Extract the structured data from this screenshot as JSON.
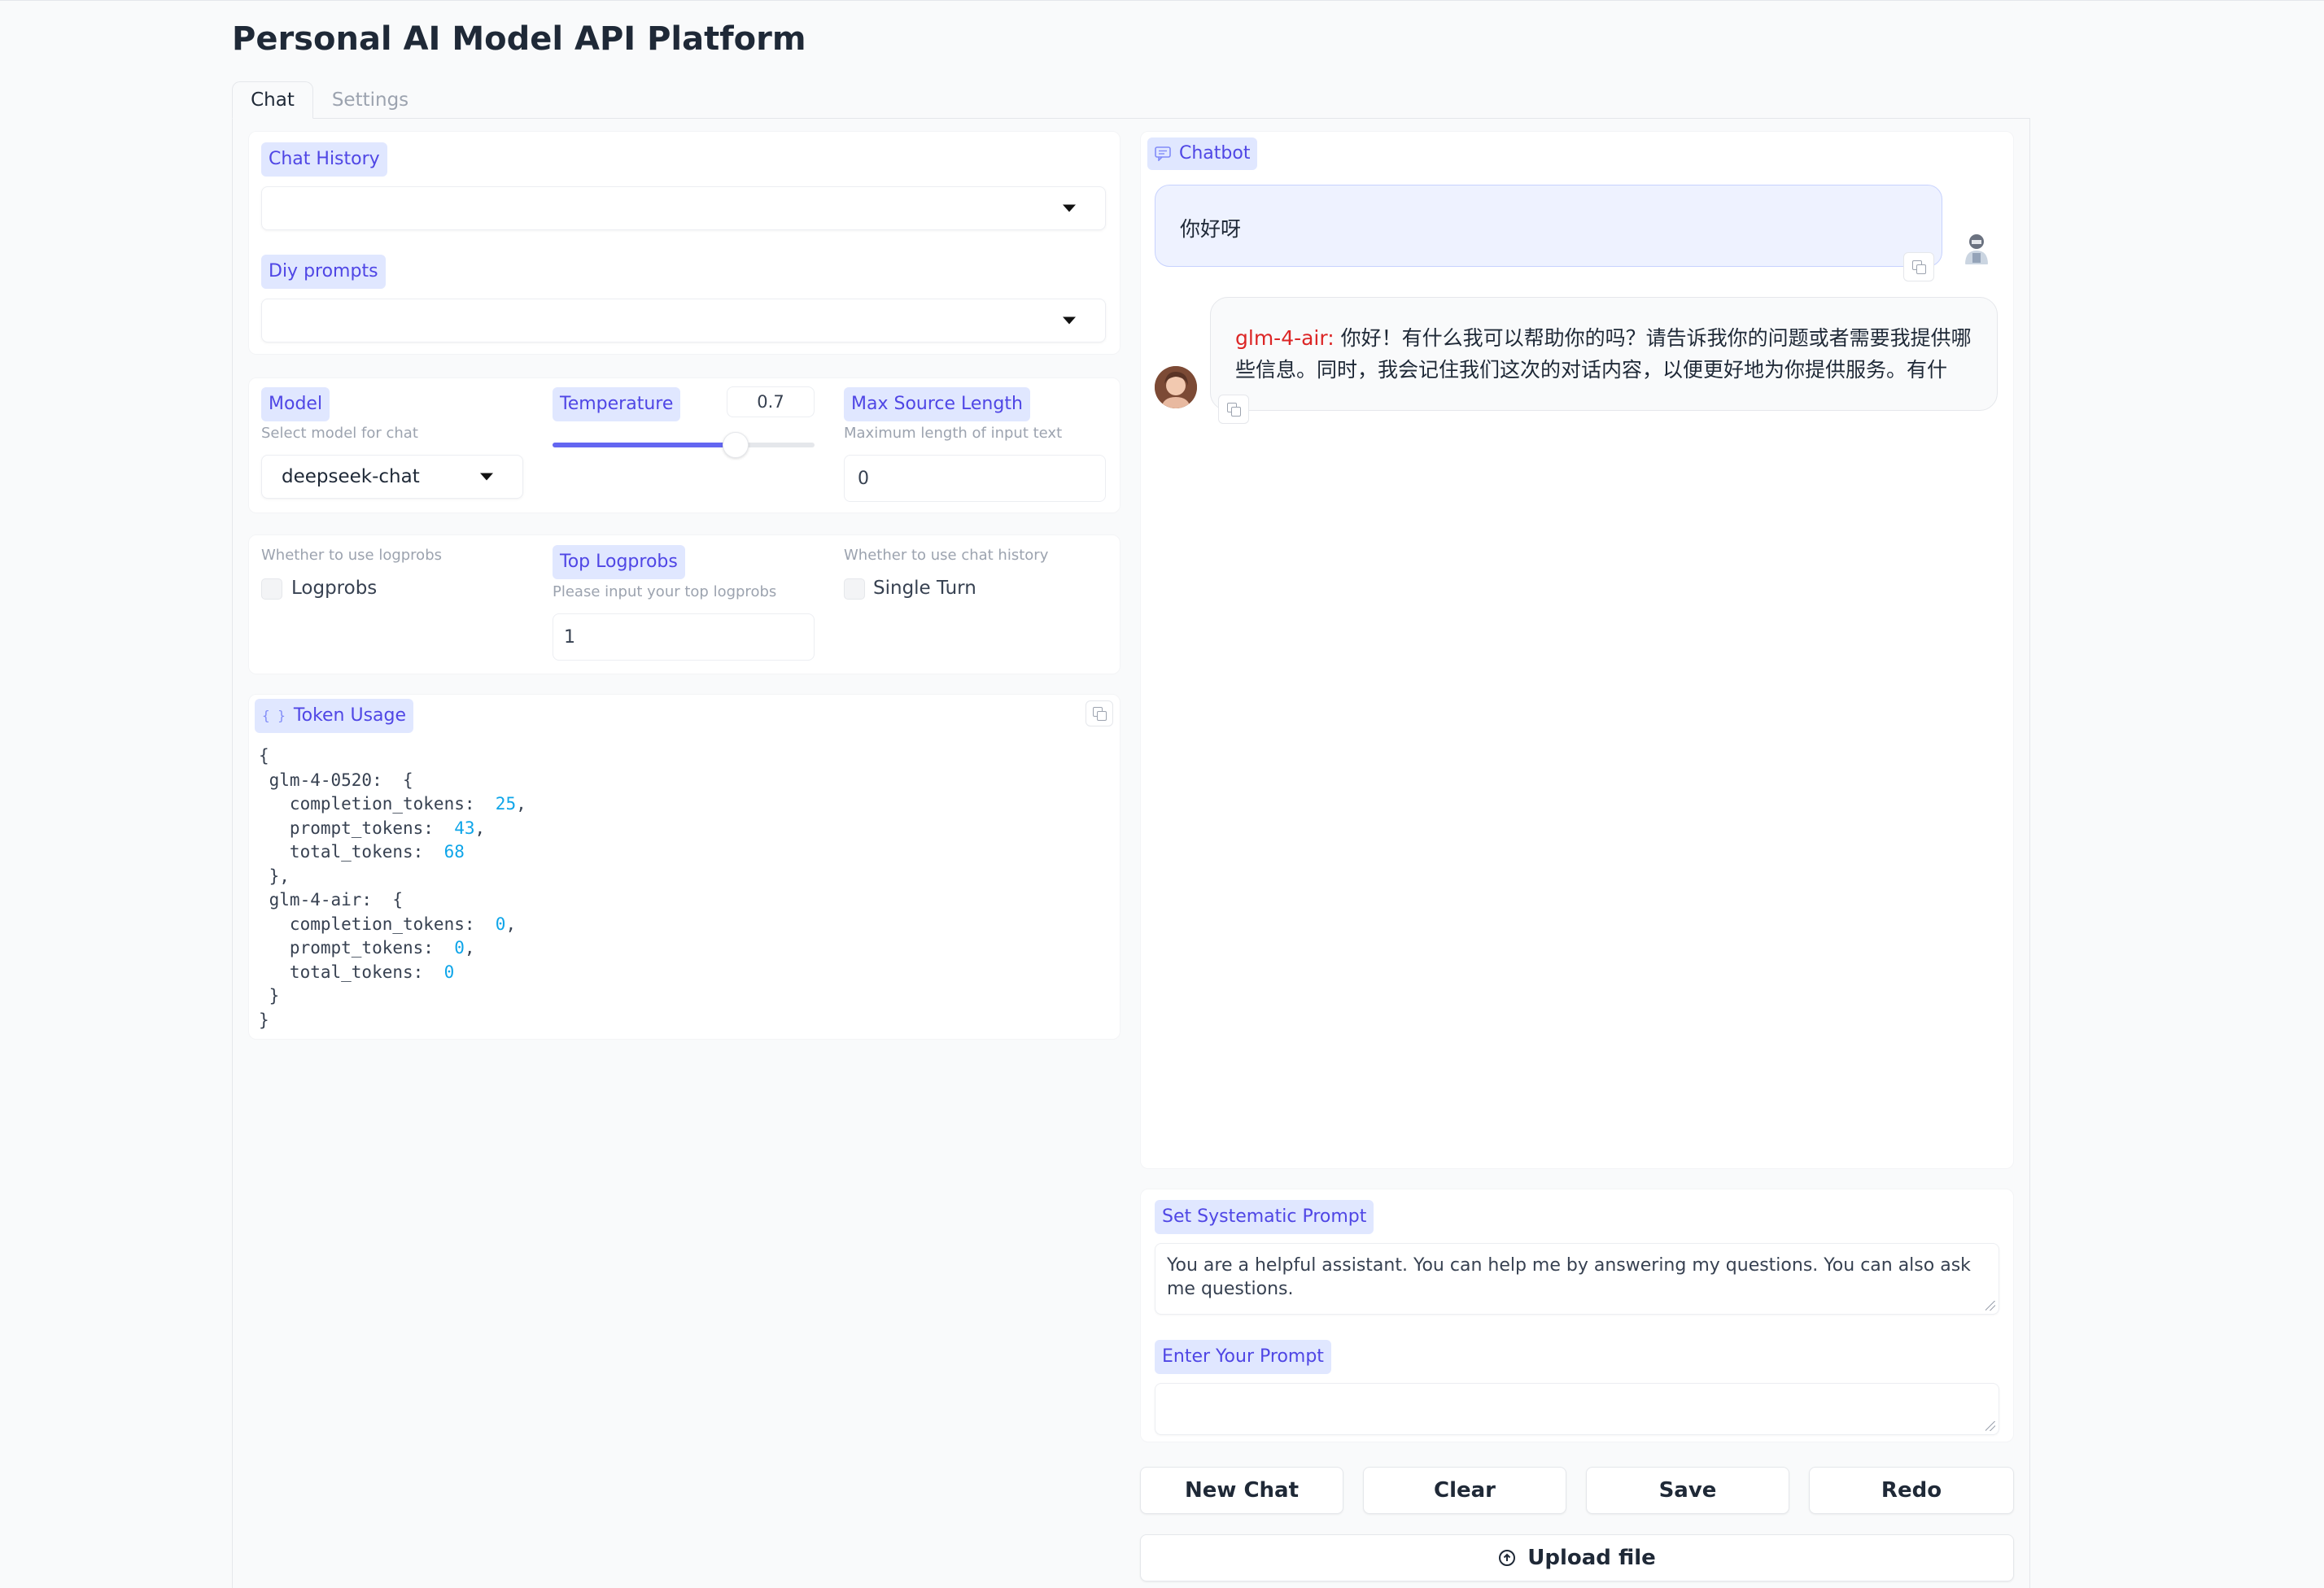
{
  "app": {
    "title": "Personal AI Model API Platform",
    "tabs": [
      "Chat",
      "Settings"
    ]
  },
  "left": {
    "chat_history": {
      "label": "Chat History",
      "value": ""
    },
    "diy_prompts": {
      "label": "Diy prompts",
      "value": ""
    },
    "model": {
      "label": "Model",
      "info": "Select model for chat",
      "value": "deepseek-chat"
    },
    "temperature": {
      "label": "Temperature",
      "value": "0.7",
      "fraction": 0.7
    },
    "max_source_length": {
      "label": "Max Source Length",
      "info": "Maximum length of input text",
      "value": "0"
    },
    "logprobs": {
      "info": "Whether to use logprobs",
      "label": "Logprobs",
      "checked": false
    },
    "top_logprobs": {
      "label": "Top Logprobs",
      "info": "Please input your top logprobs",
      "value": "1"
    },
    "single_turn": {
      "info": "Whether to use chat history",
      "label": "Single Turn",
      "checked": false
    },
    "token_usage": {
      "label": "Token Usage",
      "lines": [
        {
          "t": "{"
        },
        {
          "t": " glm-4-0520:  {"
        },
        {
          "t": "   completion_tokens:  ",
          "n": "25",
          "s": ","
        },
        {
          "t": "   prompt_tokens:  ",
          "n": "43",
          "s": ","
        },
        {
          "t": "   total_tokens:  ",
          "n": "68",
          "s": ""
        },
        {
          "t": " },"
        },
        {
          "t": " glm-4-air:  {"
        },
        {
          "t": "   completion_tokens:  ",
          "n": "0",
          "s": ","
        },
        {
          "t": "   prompt_tokens:  ",
          "n": "0",
          "s": ","
        },
        {
          "t": "   total_tokens:  ",
          "n": "0",
          "s": ""
        },
        {
          "t": " }"
        },
        {
          "t": "}"
        }
      ]
    }
  },
  "chatbot": {
    "label": "Chatbot",
    "messages": [
      {
        "role": "user",
        "text": "你好呀"
      },
      {
        "role": "bot",
        "model": "glm-4-air:",
        "text": " 你好！有什么我可以帮助你的吗？请告诉我你的问题或者需要我提供哪些信息。同时，我会记住我们这次的对话内容，以便更好地为你提供服务。有什"
      }
    ]
  },
  "system_prompt": {
    "label": "Set Systematic Prompt",
    "value": "You are a helpful assistant. You can help me by answering my questions. You can also ask me questions."
  },
  "user_prompt": {
    "label": "Enter Your Prompt",
    "value": ""
  },
  "buttons": {
    "new_chat": "New Chat",
    "clear": "Clear",
    "save": "Save",
    "redo": "Redo",
    "upload": "Upload file"
  },
  "colors": {
    "accent": "#4f46e5",
    "label_bg": "#e0e7ff",
    "user_bubble": "#eef2ff",
    "model_name": "#dc2626"
  }
}
